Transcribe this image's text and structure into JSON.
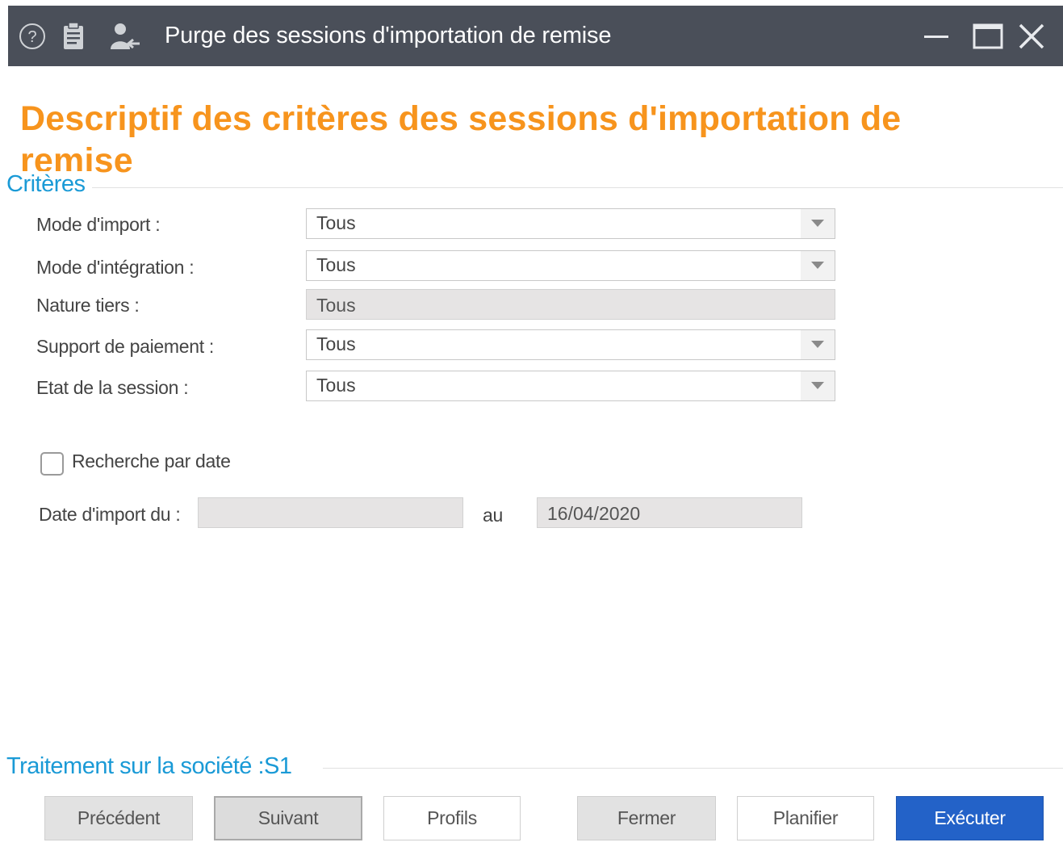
{
  "window": {
    "title": "Purge des sessions d'importation de remise"
  },
  "page": {
    "heading": "Descriptif des critères des sessions d'importation de remise"
  },
  "criteria": {
    "section_title": "Critères",
    "mode_import": {
      "label": "Mode d'import :",
      "value": "Tous"
    },
    "mode_integration": {
      "label": "Mode d'intégration :",
      "value": "Tous"
    },
    "nature_tiers": {
      "label": "Nature tiers :",
      "value": "Tous"
    },
    "support_paiement": {
      "label": "Support de paiement :",
      "value": "Tous"
    },
    "etat_session": {
      "label": "Etat de la session :",
      "value": "Tous"
    },
    "date_search": {
      "label": "Recherche par date",
      "checked": false
    },
    "date_from": {
      "label": "Date d'import du :",
      "value": ""
    },
    "date_to": {
      "label": "au",
      "value": "16/04/2020"
    }
  },
  "company": {
    "section_title": "Traitement sur la société :S1"
  },
  "buttons": {
    "previous": "Précédent",
    "next": "Suivant",
    "profiles": "Profils",
    "close": "Fermer",
    "schedule": "Planifier",
    "execute": "Exécuter"
  },
  "colors": {
    "titlebar": "#4a4f59",
    "heading": "#f7941d",
    "section": "#1a9ad6",
    "primary_button": "#2362c8"
  },
  "icons": {
    "help": "help-circle-icon",
    "notes": "clipboard-icon",
    "user": "user-export-icon",
    "minimize": "minimize-icon",
    "maximize": "maximize-icon",
    "close": "close-icon",
    "dropdown": "chevron-down-icon"
  }
}
